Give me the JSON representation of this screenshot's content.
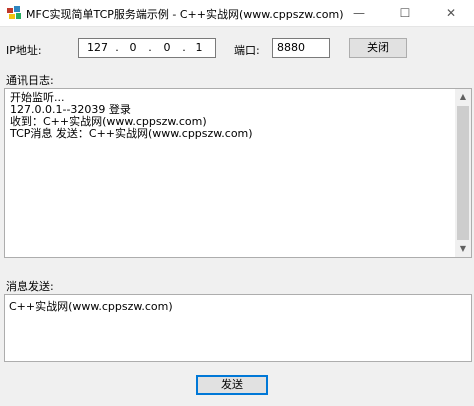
{
  "window": {
    "title": "MFC实现简单TCP服务端示例 - C++实战网(www.cppszw.com)",
    "minimize": "—",
    "maximize": "☐",
    "close": "✕"
  },
  "connection": {
    "ip_label": "IP地址:",
    "ip_octets": [
      "127",
      "0",
      "0",
      "1"
    ],
    "port_label": "端口:",
    "port_value": "8880",
    "close_button": "关闭"
  },
  "log": {
    "label": "通讯日志:",
    "lines": [
      "开始监听...",
      "127.0.0.1--32039 登录",
      "收到：C++实战网(www.cppszw.com)",
      "TCP消息 发送：C++实战网(www.cppszw.com)"
    ]
  },
  "send": {
    "label": "消息发送:",
    "input_value": "C++实战网(www.cppszw.com)",
    "send_button": "发送"
  },
  "colors": {
    "background": "#f0f0f0",
    "accent": "#0078d7"
  }
}
